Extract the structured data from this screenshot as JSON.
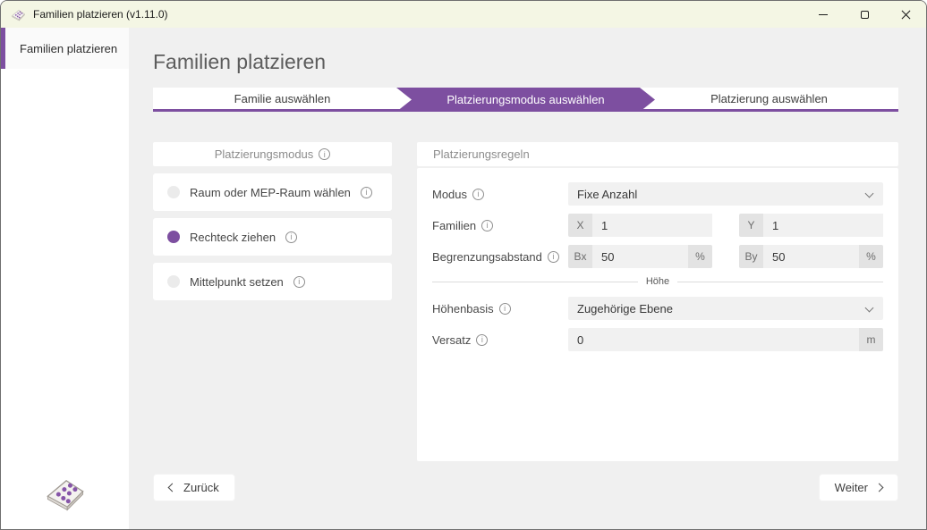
{
  "titlebar": {
    "title": "Familien platzieren (v1.11.0)"
  },
  "sidebar": {
    "item": "Familien platzieren"
  },
  "main": {
    "heading": "Familien platzieren",
    "tabs": [
      {
        "label": "Familie auswählen",
        "active": false
      },
      {
        "label": "Platzierungsmodus auswählen",
        "active": true
      },
      {
        "label": "Platzierung auswählen",
        "active": false
      }
    ],
    "mode_panel": {
      "header": "Platzierungsmodus",
      "options": [
        {
          "label": "Raum oder MEP-Raum wählen",
          "selected": false
        },
        {
          "label": "Rechteck ziehen",
          "selected": true
        },
        {
          "label": "Mittelpunkt setzen",
          "selected": false
        }
      ]
    },
    "rules_panel": {
      "header": "Platzierungsregeln",
      "modus": {
        "label": "Modus",
        "value": "Fixe Anzahl"
      },
      "familien": {
        "label": "Familien",
        "x_prefix": "X",
        "x_value": "1",
        "y_prefix": "Y",
        "y_value": "1"
      },
      "begrenzung": {
        "label": "Begrenzungsabstand",
        "bx_prefix": "Bx",
        "bx_value": "50",
        "bx_unit": "%",
        "by_prefix": "By",
        "by_value": "50",
        "by_unit": "%"
      },
      "hoehe_divider": "Höhe",
      "hoehenbasis": {
        "label": "Höhenbasis",
        "value": "Zugehörige Ebene"
      },
      "versatz": {
        "label": "Versatz",
        "value": "0",
        "unit": "m"
      }
    },
    "buttons": {
      "back": "Zurück",
      "next": "Weiter"
    }
  },
  "icons": {
    "info": "i",
    "app_icon": "dice-tile-icon",
    "minimize": "minimize-icon",
    "maximize": "maximize-icon",
    "close": "close-icon"
  },
  "colors": {
    "accent": "#7d4fa0",
    "titlebar_bg": "#f4f6e4",
    "main_bg": "#f0f0f0",
    "input_bg": "#f1f1f1",
    "affix_bg": "#e3e3e3"
  }
}
